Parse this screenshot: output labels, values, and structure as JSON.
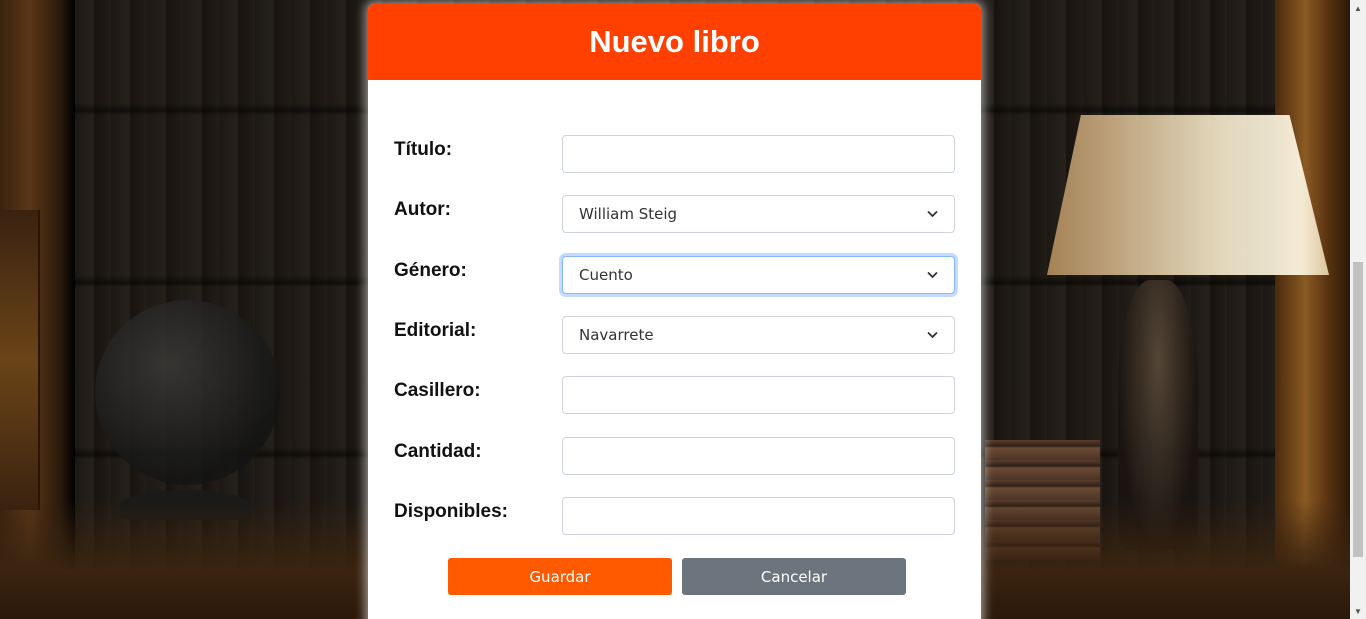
{
  "form": {
    "title": "Nuevo libro",
    "fields": [
      {
        "label": "Título:",
        "type": "text",
        "value": ""
      },
      {
        "label": "Autor:",
        "type": "select",
        "value": "William Steig"
      },
      {
        "label": "Género:",
        "type": "select",
        "value": "Cuento"
      },
      {
        "label": "Editorial:",
        "type": "select",
        "value": "Navarrete"
      },
      {
        "label": "Casillero:",
        "type": "text",
        "value": ""
      },
      {
        "label": "Cantidad:",
        "type": "text",
        "value": ""
      },
      {
        "label": "Disponibles:",
        "type": "text",
        "value": ""
      }
    ],
    "save_label": "Guardar",
    "cancel_label": "Cancelar"
  },
  "colors": {
    "header": "#ff4000",
    "save_button": "#ff5a00",
    "cancel_button": "#6c757d"
  },
  "icons": {
    "select_arrow": "chevron-down-icon"
  }
}
